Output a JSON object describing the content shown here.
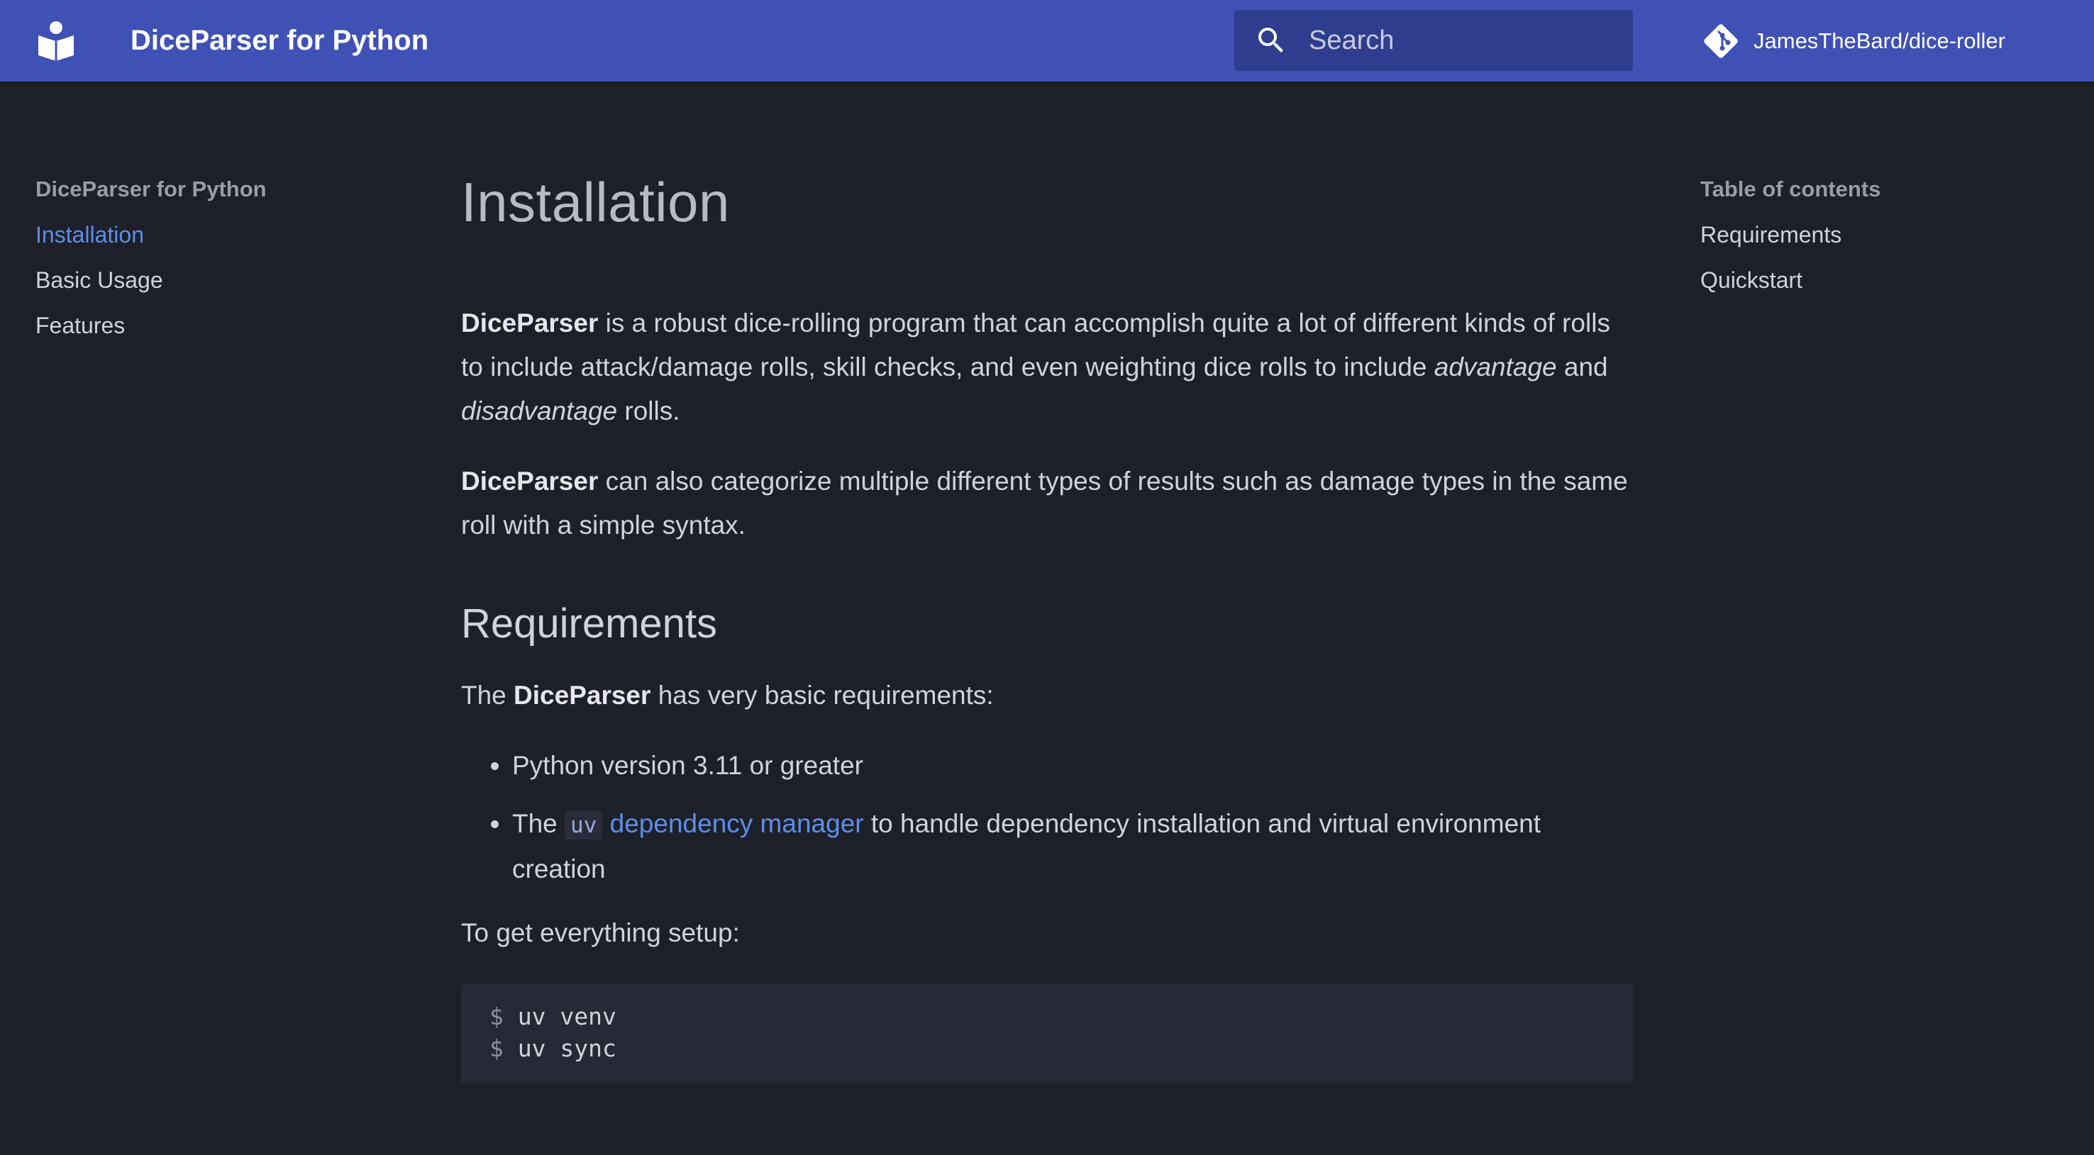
{
  "header": {
    "site_title": "DiceParser for Python",
    "logo_icon": "book-reader-icon",
    "search_placeholder": "Search",
    "repo_icon": "git-icon",
    "repo_label": "JamesTheBard/dice-roller",
    "background_color": "#3f51b5"
  },
  "nav": {
    "title": "DiceParser for Python",
    "items": [
      {
        "label": "Installation",
        "active": true
      },
      {
        "label": "Basic Usage",
        "active": false
      },
      {
        "label": "Features",
        "active": false
      }
    ],
    "active_color": "#5c8fea"
  },
  "toc": {
    "title": "Table of contents",
    "items": [
      {
        "label": "Requirements"
      },
      {
        "label": "Quickstart"
      }
    ]
  },
  "main": {
    "title": "Installation",
    "intro": {
      "product": "DiceParser",
      "text1": " is a robust dice-rolling program that can accomplish quite a lot of different kinds of rolls to include attack/damage rolls, skill checks, and even weighting dice rolls to include ",
      "em1": "advantage",
      "and": " and ",
      "em2": "disadvantage",
      "text2": " rolls."
    },
    "para2": {
      "product": "DiceParser",
      "text": " can also categorize multiple different types of results such as damage types in the same roll with a simple syntax."
    },
    "requirements": {
      "heading": "Requirements",
      "intro_prefix": "The ",
      "intro_product": "DiceParser",
      "intro_suffix": " has very basic requirements:",
      "item1": "Python version 3.11 or greater",
      "item2_prefix": "The ",
      "item2_code": "uv",
      "item2_link": "dependency manager",
      "item2_suffix": " to handle dependency installation and virtual environment creation",
      "setup_text": "To get everything setup:",
      "code_lines": [
        {
          "prompt": "$",
          "command": "uv venv"
        },
        {
          "prompt": "$",
          "command": "uv sync"
        }
      ]
    }
  }
}
